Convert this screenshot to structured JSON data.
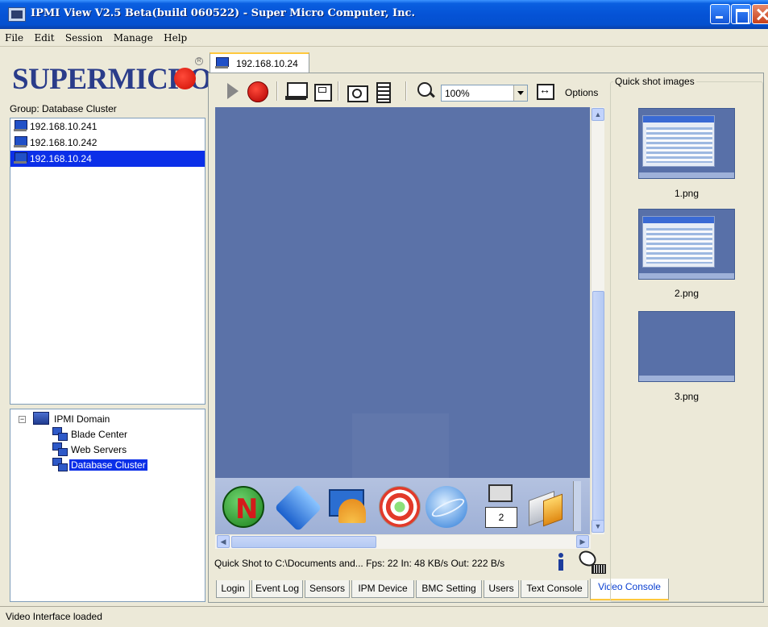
{
  "window": {
    "title": "IPMI View V2.5 Beta(build 060522) - Super Micro Computer, Inc."
  },
  "menu": [
    "File",
    "Edit",
    "Session",
    "Manage",
    "Help"
  ],
  "sidebar": {
    "logo": "SUPERMICRO",
    "group_label": "Group: Database Cluster",
    "hosts": [
      "192.168.10.241",
      "192.168.10.242",
      "192.168.10.24"
    ],
    "selected_host": "192.168.10.24",
    "tree": {
      "root": "IPMI Domain",
      "groups": [
        "Blade Center",
        "Web Servers",
        "Database Cluster"
      ],
      "selected_group": "Database Cluster"
    }
  },
  "session": {
    "tab_label": "192.168.10.24",
    "toolbar": {
      "zoom": "100%",
      "options_label": "Options",
      "icons": [
        "play-icon",
        "stop-icon",
        "monitor-icon",
        "floppy-icon",
        "camera-icon",
        "film-icon",
        "zoom-icon",
        "fit-screen-icon"
      ]
    },
    "remote_desktop": {
      "background_color": "#5b72a8",
      "taskbar_icons": [
        "novell-icon",
        "home-icon",
        "shell-icon",
        "help-icon",
        "browser-icon",
        "virtual-desktop-icon",
        "office-icon"
      ],
      "virtual_desktop_number": "2"
    },
    "status_text": "Quick Shot to C:\\Documents and...  Fps: 22 In: 48 KB/s Out: 222 B/s",
    "tabs": [
      "Login",
      "Event Log",
      "Sensors",
      "IPM Device",
      "BMC Setting",
      "Users",
      "Text Console",
      "Video Console"
    ],
    "active_tab": "Video Console"
  },
  "quick_shots": {
    "title": "Quick shot images",
    "images": [
      "1.png",
      "2.png",
      "3.png"
    ]
  },
  "statusbar": {
    "text": "Video Interface loaded"
  },
  "colors": {
    "titlebar": "#0553d6",
    "selection": "#0b2fe8",
    "logo_text": "#2a3c8a",
    "logo_dot": "#cc0b00",
    "active_tab_text": "#0a3fd0"
  }
}
